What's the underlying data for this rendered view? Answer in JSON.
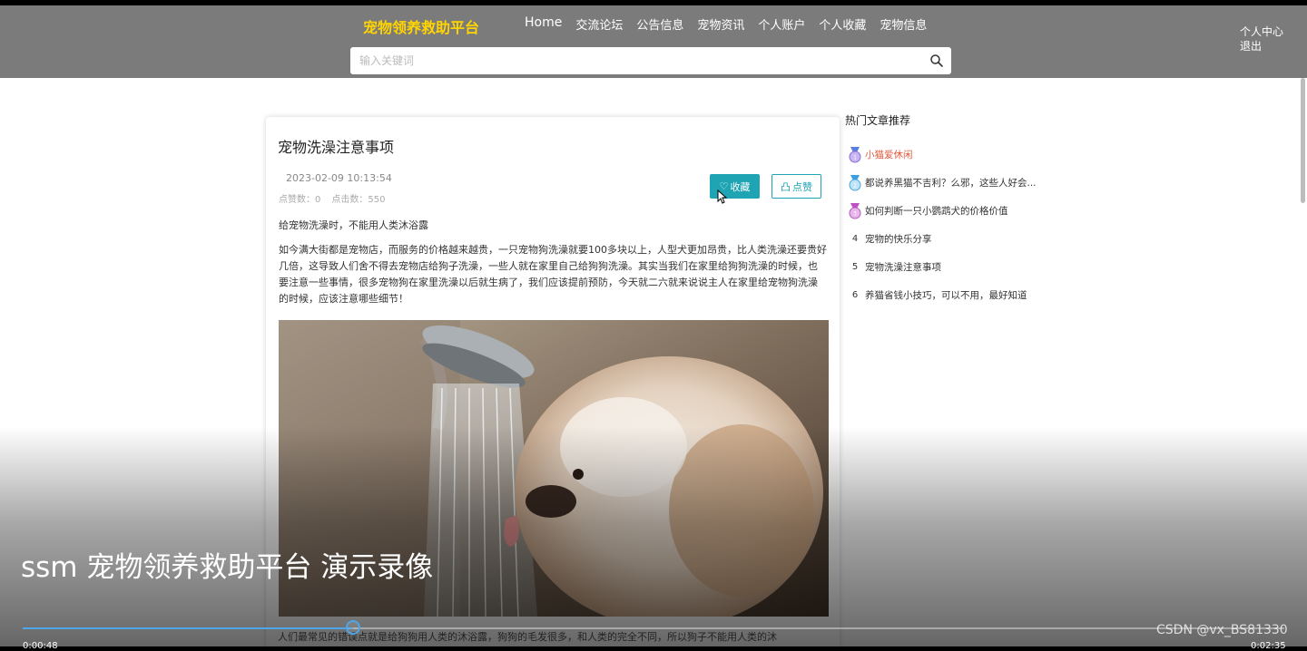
{
  "header": {
    "brand": "宠物领养救助平台",
    "nav": [
      "Home",
      "交流论坛",
      "公告信息",
      "宠物资讯",
      "个人账户",
      "个人收藏",
      "宠物信息"
    ],
    "user_center": "个人中心",
    "logout": "退出"
  },
  "search": {
    "placeholder": "输入关键词"
  },
  "article": {
    "title": "宠物洗澡注意事项",
    "date": "2023-02-09 10:13:54",
    "likes": "点赞数：0",
    "clicks": "点击数：550",
    "fav_button": "收藏",
    "like_button": "点赞",
    "para1": "给宠物洗澡时，不能用人类沐浴露",
    "para2": "如今满大街都是宠物店，而服务的价格越来越贵，一只宠物狗洗澡就要100多块以上，人型犬更加昂贵，比人类洗澡还要贵好几倍，这导致人们舍不得去宠物店给狗子洗澡，一些人就在家里自己给狗狗洗澡。其实当我们在家里给狗狗洗澡的时候，也要注意一些事情，很多宠物狗在家里洗澡以后就生病了，我们应该提前预防，今天就二六就来说说主人在家里给宠物狗洗澡的时候，应该注意哪些细节！",
    "bottom_text": "人们最常见的错误点就是给狗狗用人类的沐浴露，狗狗的毛发很多，和人类的完全不同，所以狗子不能用人类的沐"
  },
  "sidebar": {
    "title": "热门文章推荐",
    "items": [
      {
        "rank": "1",
        "label": "小猫爱休闲"
      },
      {
        "rank": "2",
        "label": "都说养黑猫不吉利？么邪，这些人好会..."
      },
      {
        "rank": "3",
        "label": "如何判断一只小鹦鹉犬的价格价值"
      },
      {
        "rank": "4",
        "label": "宠物的快乐分享"
      },
      {
        "rank": "5",
        "label": "宠物洗澡注意事项"
      },
      {
        "rank": "6",
        "label": "养猫省钱小技巧，可以不用，最好知道"
      }
    ]
  },
  "video": {
    "title": "ssm 宠物领养救助平台 演示录像",
    "progress": 0.262,
    "time_current": "0:00:48",
    "time_total": "0:02:35",
    "watermark": "CSDN @vx_BS81330"
  },
  "colors": {
    "header_bg": "#7b7b7b",
    "brand": "#ffd400",
    "accent": "#1ea4b3",
    "progress": "#4ea6e8"
  }
}
